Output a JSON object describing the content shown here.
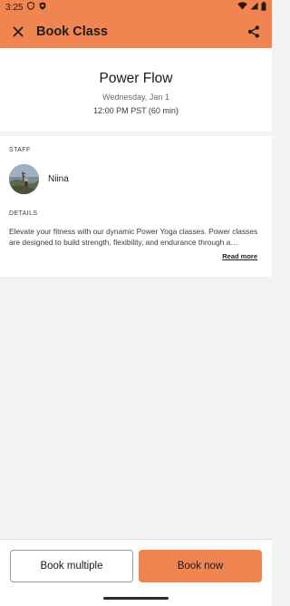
{
  "status_bar": {
    "time": "3:25",
    "icons": [
      "shield-icon",
      "notification-icon",
      "wifi-icon",
      "signal-icon",
      "battery-icon"
    ]
  },
  "toolbar": {
    "title": "Book Class",
    "close_icon": "close-icon",
    "share_icon": "share-icon",
    "background": "#f08552"
  },
  "class_info": {
    "name": "Power Flow",
    "date": "Wednesday, Jan 1",
    "time": "12:00 PM PST (60 min)"
  },
  "staff": {
    "label": "STAFF",
    "name": "Niina"
  },
  "details": {
    "label": "DETAILS",
    "text": "Elevate your fitness with our dynamic Power Yoga classes. Power classes are designed to build strength, flexibility, and endurance through a challenging flow.",
    "read_more": "Read more"
  },
  "actions": {
    "book_multiple": "Book multiple",
    "book_now": "Book now",
    "accent": "#f08552"
  }
}
